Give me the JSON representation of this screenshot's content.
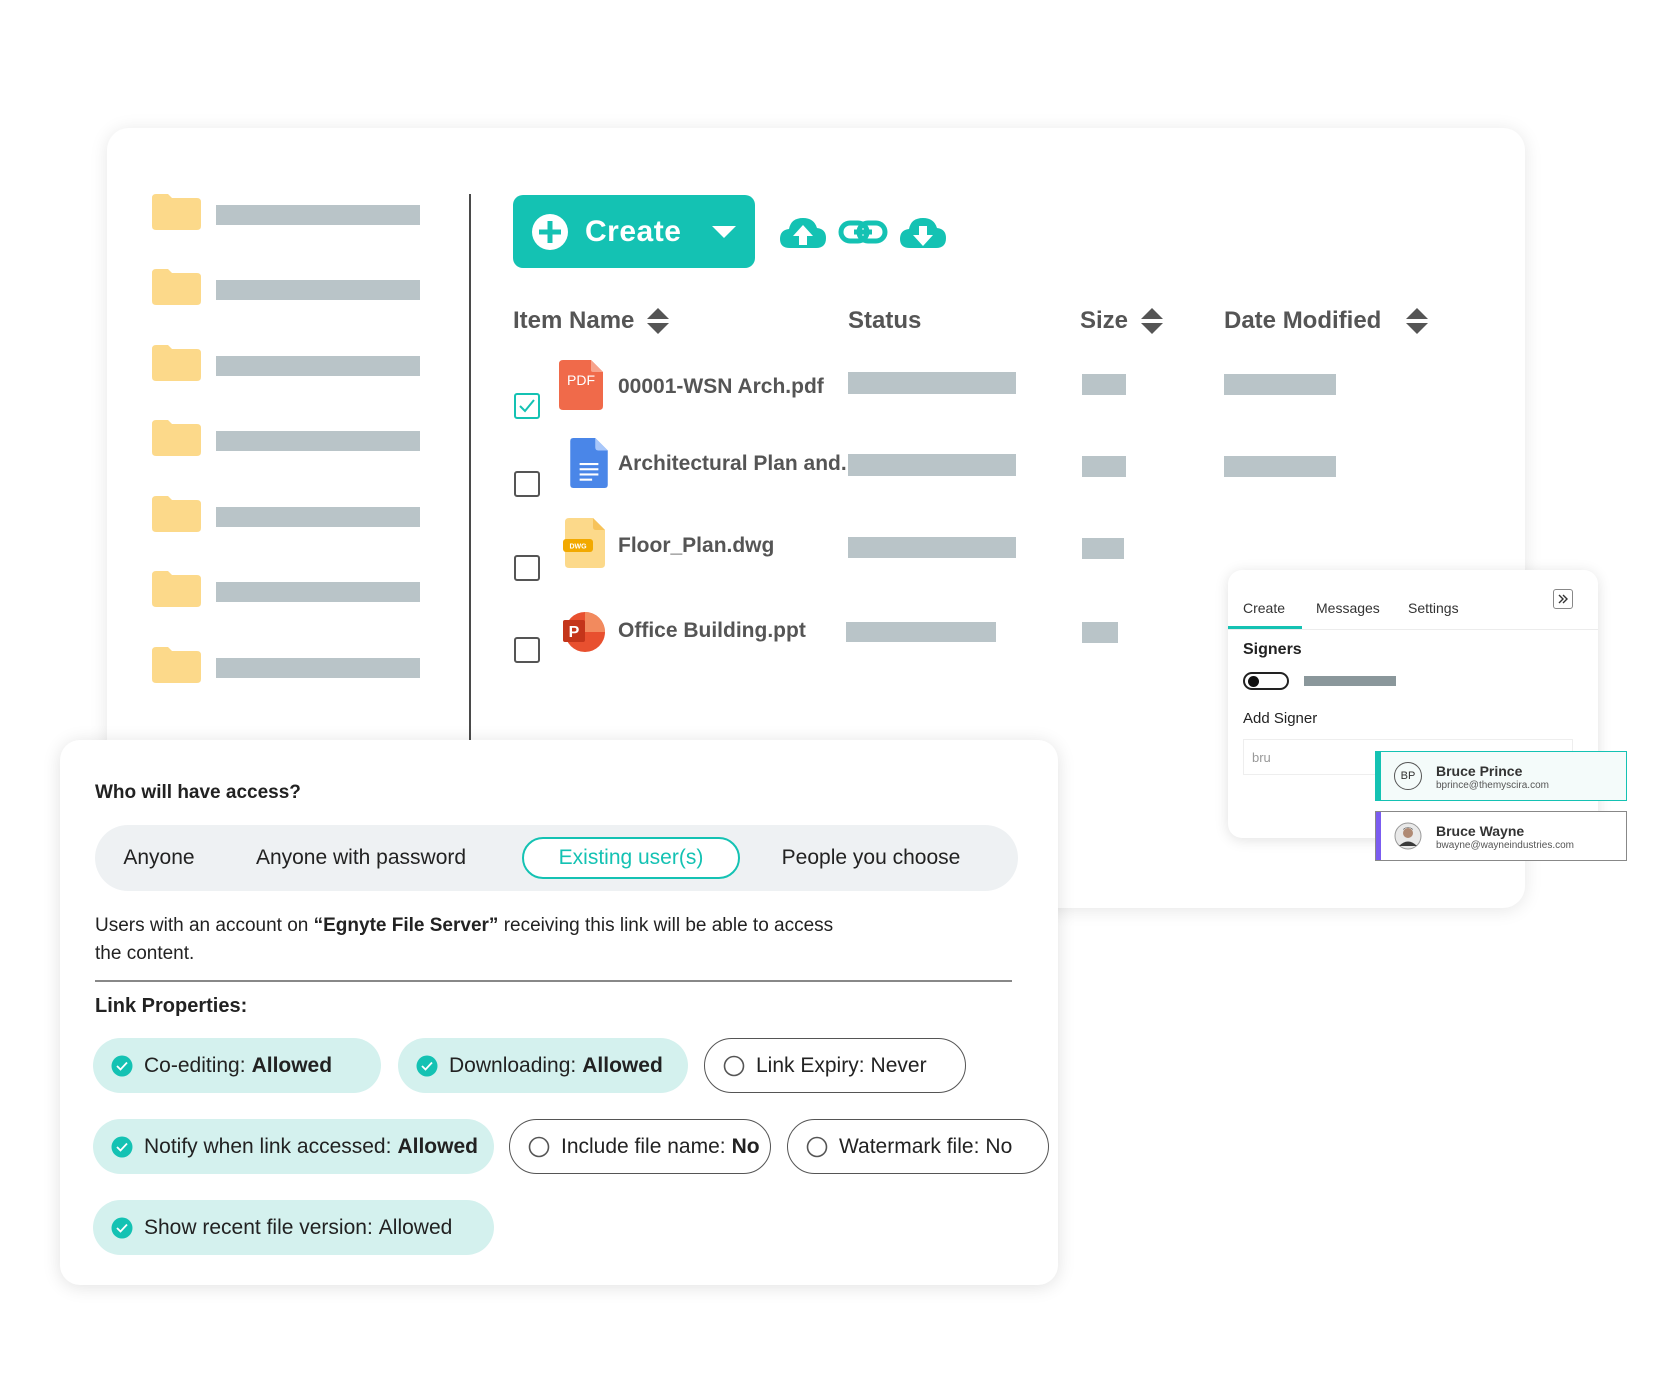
{
  "toolbar": {
    "create_label": "Create",
    "icons": [
      "upload-cloud-icon",
      "link-icon",
      "download-cloud-icon"
    ]
  },
  "columns": {
    "name": "Item Name",
    "status": "Status",
    "size": "Size",
    "modified": "Date Modified"
  },
  "files": [
    {
      "name": "00001-WSN Arch.pdf",
      "icon": "pdf-file-icon",
      "icon_text": "PDF",
      "checked": true
    },
    {
      "name": "Architectural Plan and...",
      "icon": "google-doc-icon",
      "checked": false
    },
    {
      "name": "Floor_Plan.dwg",
      "icon": "dwg-file-icon",
      "icon_text": "DWG",
      "checked": false
    },
    {
      "name": "Office Building.ppt",
      "icon": "powerpoint-file-icon",
      "icon_text": "P",
      "checked": false
    }
  ],
  "sign_panel": {
    "tabs": [
      "Create",
      "Messages",
      "Settings"
    ],
    "active_tab": "Create",
    "signers_label": "Signers",
    "add_signer_label": "Add Signer",
    "input_value": "bru",
    "suggestions": [
      {
        "initials": "BP",
        "name": "Bruce Prince",
        "email": "bprince@themyscira.com",
        "accent": "#14c2b3"
      },
      {
        "initials": "",
        "name": "Bruce Wayne",
        "email": "bwayne@wayneindustries.com",
        "accent": "#7b5cf0"
      }
    ]
  },
  "access": {
    "question": "Who will have access?",
    "options": [
      "Anyone",
      "Anyone with password",
      "Existing user(s)",
      "People you choose"
    ],
    "selected": "Existing user(s)",
    "description_prefix": "Users with an account on ",
    "description_bold": "“Egnyte File Server”",
    "description_suffix": " receiving this link will be able to access the content.",
    "link_properties_label": "Link Properties:",
    "properties": [
      {
        "label": "Co-editing:",
        "value": "Allowed",
        "enabled": true
      },
      {
        "label": "Downloading:",
        "value": "Allowed",
        "enabled": true
      },
      {
        "label": "Link Expiry:",
        "value": "Never",
        "enabled": false
      },
      {
        "label": "Notify when link accessed:",
        "value": "Allowed",
        "enabled": true
      },
      {
        "label": "Include file name:",
        "value": "No",
        "enabled": false
      },
      {
        "label": "Watermark file:",
        "value": "No",
        "enabled": false
      },
      {
        "label": "Show recent file version:",
        "value": "Allowed",
        "enabled": true
      }
    ]
  },
  "colors": {
    "accent": "#14c2b3",
    "placeholder_bar": "#b9c4c8",
    "folder": "#fcd98a",
    "chip_on": "#d4f1ee"
  }
}
